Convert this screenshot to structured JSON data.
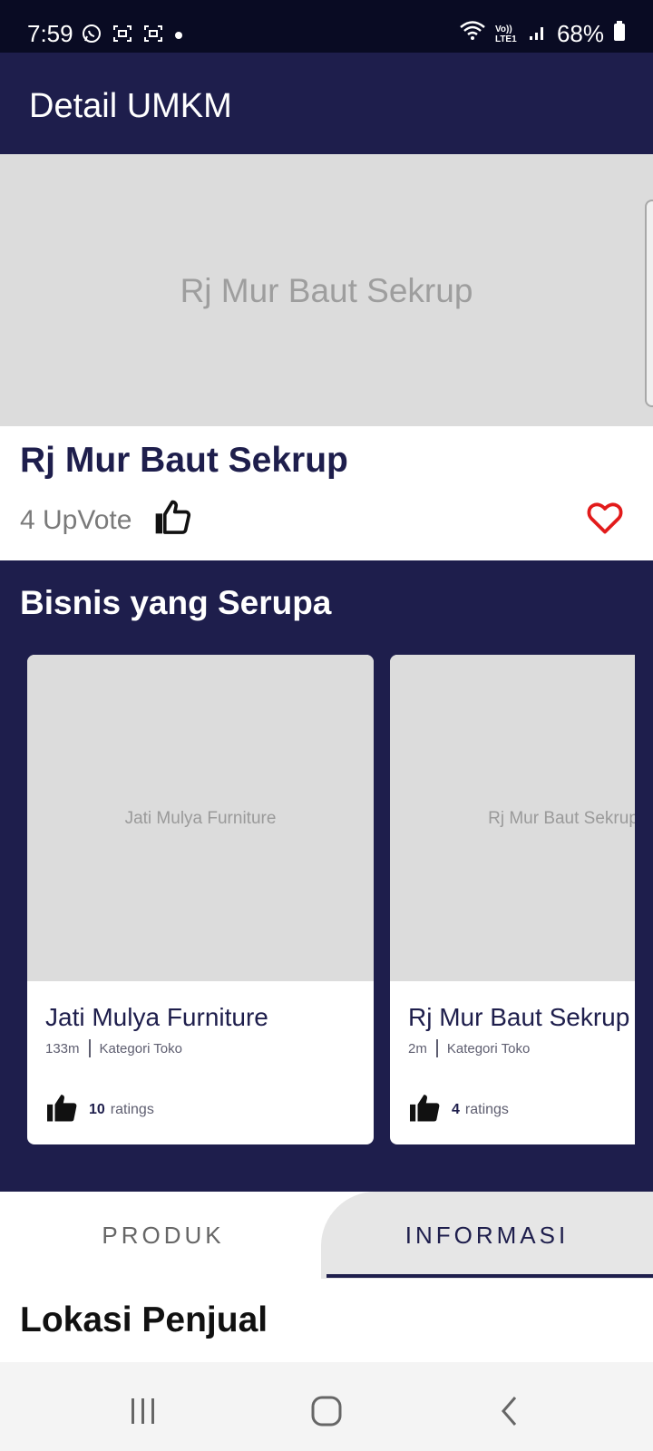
{
  "status_bar": {
    "time": "7:59",
    "battery": "68%",
    "network_label": "Vo)) LTE1"
  },
  "app_bar": {
    "title": "Detail UMKM"
  },
  "hero": {
    "placeholder": "Rj Mur Baut Sekrup"
  },
  "store": {
    "name": "Rj Mur Baut Sekrup",
    "upvote_text": "4 UpVote"
  },
  "similar": {
    "title": "Bisnis yang Serupa",
    "cards": [
      {
        "placeholder": "Jati Mulya Furniture",
        "name": "Jati Mulya Furniture",
        "distance": "133m",
        "category": "Kategori Toko",
        "rating_count": "10",
        "rating_label": "ratings"
      },
      {
        "placeholder": "Rj Mur Baut Sekrup",
        "name": "Rj Mur Baut Sekrup",
        "distance": "2m",
        "category": "Kategori Toko",
        "rating_count": "4",
        "rating_label": "ratings"
      }
    ]
  },
  "tabs": {
    "items": [
      {
        "label": "PRODUK",
        "selected": false
      },
      {
        "label": "INFORMASI",
        "selected": true
      }
    ]
  },
  "section": {
    "title": "Lokasi Penjual"
  },
  "colors": {
    "primary": "#1e1e4c",
    "status_bar": "#090b23",
    "placeholder_bg": "#dcdcdc",
    "heart": "#e21b1b"
  },
  "icons": [
    "whatsapp-icon",
    "screen-record-icon",
    "wifi-icon",
    "signal-icon",
    "battery-icon",
    "thumbs-up-icon",
    "heart-icon",
    "recent-apps-icon",
    "home-icon",
    "back-icon"
  ]
}
